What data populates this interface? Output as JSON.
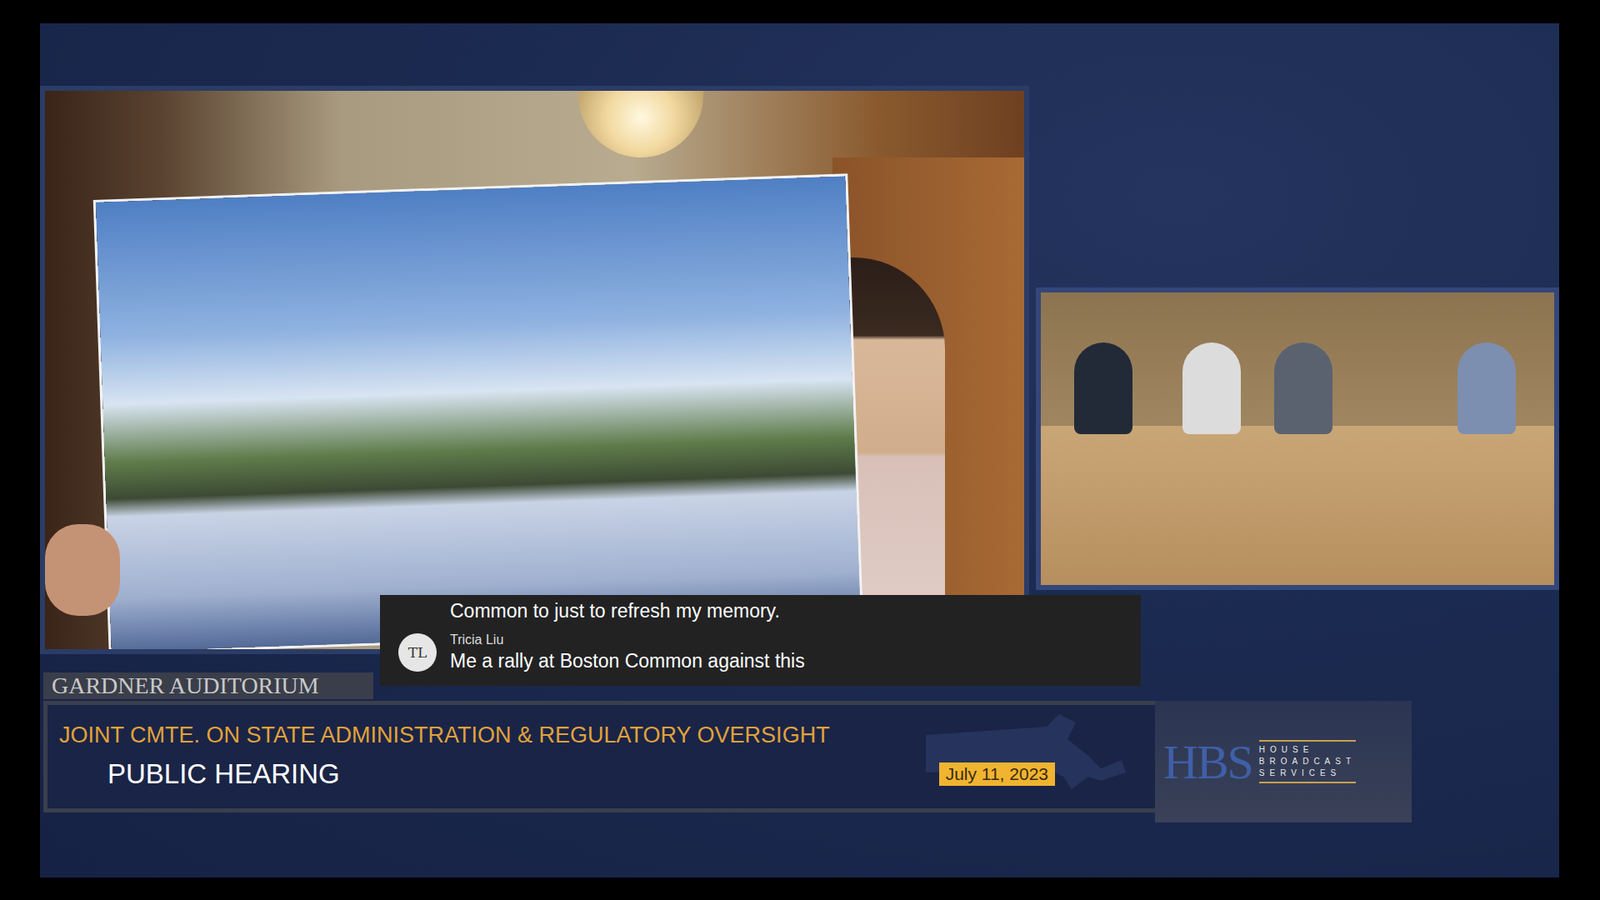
{
  "broadcast": {
    "location": "GARDNER AUDITORIUM",
    "committee": "JOINT CMTE. ON STATE ADMINISTRATION & REGULATORY OVERSIGHT",
    "event": "PUBLIC HEARING",
    "date": "July 11, 2023"
  },
  "logo": {
    "mark": "HBS",
    "words": [
      "HOUSE",
      "BROADCAST",
      "SERVICES"
    ]
  },
  "captions": {
    "previous": "Common to just to refresh my memory.",
    "speaker": {
      "initials": "TL",
      "name": "Tricia Liu"
    },
    "text": "Me a rally at Boston Common against this"
  }
}
